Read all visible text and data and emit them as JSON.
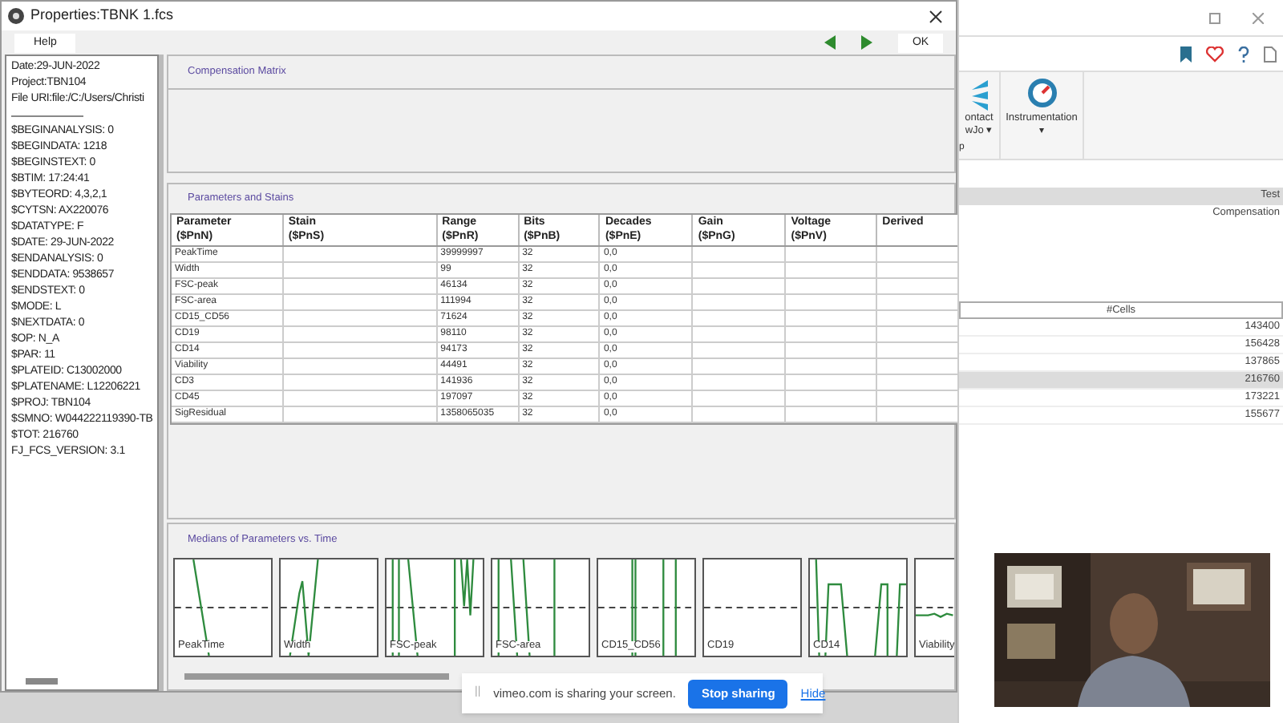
{
  "dialog": {
    "title": "Properties:TBNK 1.fcs",
    "help_button": "Help",
    "ok_button": "OK",
    "metadata": [
      "Date:29-JUN-2022",
      "Project:TBN104",
      "File URI:file:/C:/Users/Christi",
      "$BEGINANALYSIS: 0",
      "$BEGINDATA: 1218",
      "$BEGINSTEXT: 0",
      "$BTIM: 17:24:41",
      "$BYTEORD: 4,3,2,1",
      "$CYTSN: AX220076",
      "$DATATYPE: F",
      "$DATE: 29-JUN-2022",
      "$ENDANALYSIS: 0",
      "$ENDDATA: 9538657",
      "$ENDSTEXT: 0",
      "$MODE: L",
      "$NEXTDATA: 0",
      "$OP: N_A",
      "$PAR: 11",
      "$PLATEID: C13002000",
      "$PLATENAME: L12206221",
      "$PROJ: TBN104",
      "$SMNO: W044222119390-TB",
      "$TOT: 216760",
      "FJ_FCS_VERSION: 3.1"
    ],
    "compensation_title": "Compensation Matrix",
    "parameters_title": "Parameters and Stains",
    "columns": [
      [
        "Parameter",
        "($PnN)"
      ],
      [
        "Stain",
        "($PnS)"
      ],
      [
        "Range",
        "($PnR)"
      ],
      [
        "Bits",
        "($PnB)"
      ],
      [
        "Decades",
        "($PnE)"
      ],
      [
        "Gain",
        "($PnG)"
      ],
      [
        "Voltage",
        "($PnV)"
      ],
      [
        "Derived"
      ]
    ],
    "rows": [
      {
        "parameter": "PeakTime",
        "range": "39999997",
        "bits": "32",
        "decades": "0,0"
      },
      {
        "parameter": "Width",
        "range": "99",
        "bits": "32",
        "decades": "0,0"
      },
      {
        "parameter": "FSC-peak",
        "range": "46134",
        "bits": "32",
        "decades": "0,0"
      },
      {
        "parameter": "FSC-area",
        "range": "111994",
        "bits": "32",
        "decades": "0,0"
      },
      {
        "parameter": "CD15_CD56",
        "range": "71624",
        "bits": "32",
        "decades": "0,0"
      },
      {
        "parameter": "CD19",
        "range": "98110",
        "bits": "32",
        "decades": "0,0"
      },
      {
        "parameter": "CD14",
        "range": "94173",
        "bits": "32",
        "decades": "0,0"
      },
      {
        "parameter": "Viability",
        "range": "44491",
        "bits": "32",
        "decades": "0,0"
      },
      {
        "parameter": "CD3",
        "range": "141936",
        "bits": "32",
        "decades": "0,0"
      },
      {
        "parameter": "CD45",
        "range": "197097",
        "bits": "32",
        "decades": "0,0"
      },
      {
        "parameter": "SigResidual",
        "range": "1358065035",
        "bits": "32",
        "decades": "0,0"
      }
    ],
    "medians_title": "Medians of Parameters vs. Time",
    "sparklines": [
      "PeakTime",
      "Width",
      "FSC-peak",
      "FSC-area",
      "CD15_CD56",
      "CD19",
      "CD14",
      "Viability"
    ]
  },
  "screen_share": {
    "grip": "||",
    "message": "vimeo.com is sharing your screen.",
    "stop_button": "Stop sharing",
    "hide_link": "Hide"
  },
  "background_app": {
    "ribbon_items": [
      {
        "label": "ontact",
        "sub": "wJo",
        "caret": "▾"
      },
      {
        "label": "Instrumentation",
        "caret": "▾"
      }
    ],
    "group_label": "p",
    "samples": [
      {
        "text": "Test",
        "selected": true
      },
      {
        "text": "Compensation",
        "selected": false
      }
    ],
    "cells_header": "#Cells",
    "cells": [
      {
        "value": "143400",
        "selected": false
      },
      {
        "value": "156428",
        "selected": false
      },
      {
        "value": "137865",
        "selected": false
      },
      {
        "value": "216760",
        "selected": true
      },
      {
        "value": "173221",
        "selected": false
      },
      {
        "value": "155677",
        "selected": false
      }
    ]
  }
}
